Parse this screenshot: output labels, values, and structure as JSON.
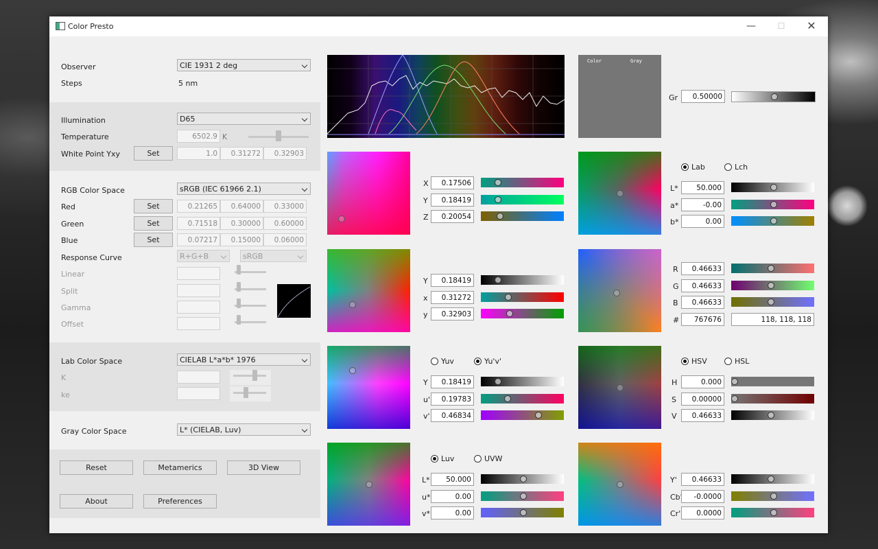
{
  "window": {
    "title": "Color Presto"
  },
  "left": {
    "observer": {
      "label": "Observer",
      "value": "CIE 1931 2 deg"
    },
    "steps": {
      "label": "Steps",
      "value": "5 nm"
    },
    "illumination": {
      "label": "Illumination",
      "value": "D65"
    },
    "temperature": {
      "label": "Temperature",
      "value": "6502.9",
      "unit": "K",
      "slider_fraction": 0.55
    },
    "white_point": {
      "label": "White Point Yxy",
      "button": "Set",
      "Y": "1.0",
      "x": "0.31272",
      "y": "0.32903"
    },
    "rgb_space": {
      "label": "RGB Color Space",
      "value": "sRGB (IEC 61966 2.1)"
    },
    "red": {
      "label": "Red",
      "button": "Set",
      "v1": "0.21265",
      "v2": "0.64000",
      "v3": "0.33000"
    },
    "green": {
      "label": "Green",
      "button": "Set",
      "v1": "0.71518",
      "v2": "0.30000",
      "v3": "0.60000"
    },
    "blue": {
      "label": "Blue",
      "button": "Set",
      "v1": "0.07217",
      "v2": "0.15000",
      "v3": "0.06000"
    },
    "response": {
      "label": "Response Curve",
      "channel": "R+G+B",
      "curve": "sRGB"
    },
    "params": [
      "Linear",
      "Split",
      "Gamma",
      "Offset"
    ],
    "lab_space": {
      "label": "Lab Color Space",
      "value": "CIELAB L*a*b* 1976",
      "k": "K",
      "ke": "ke"
    },
    "gray_space": {
      "label": "Gray Color Space",
      "value": "L* (CIELAB, Luv)"
    },
    "buttons": {
      "reset": "Reset",
      "metamerics": "Metamerics",
      "view3d": "3D View",
      "about": "About",
      "preferences": "Preferences"
    }
  },
  "gray_swatch": {
    "color_label": "Color",
    "gray_label": "Gray"
  },
  "gr": {
    "label": "Gr",
    "value": "0.50000",
    "fraction": 0.5
  },
  "xyz": {
    "rows": [
      {
        "label": "X",
        "value": "0.17506",
        "fraction": 0.18
      },
      {
        "label": "Y",
        "value": "0.18419",
        "fraction": 0.18
      },
      {
        "label": "Z",
        "value": "0.20054",
        "fraction": 0.2
      }
    ]
  },
  "yxy": {
    "rows": [
      {
        "label": "Y",
        "value": "0.18419",
        "fraction": 0.18
      },
      {
        "label": "x",
        "value": "0.31272",
        "fraction": 0.31
      },
      {
        "label": "y",
        "value": "0.32903",
        "fraction": 0.33
      }
    ]
  },
  "yuv": {
    "opt1": "Yuv",
    "opt2": "Yu'v'",
    "selected": "Yu'v'",
    "rows": [
      {
        "label": "Y",
        "value": "0.18419",
        "fraction": 0.18
      },
      {
        "label": "u'",
        "value": "0.19783",
        "fraction": 0.3
      },
      {
        "label": "v'",
        "value": "0.46834",
        "fraction": 0.7
      }
    ]
  },
  "luv": {
    "opt1": "Luv",
    "opt2": "UVW",
    "selected": "Luv",
    "rows": [
      {
        "label": "L*",
        "value": "50.000",
        "fraction": 0.5
      },
      {
        "label": "u*",
        "value": "0.00",
        "fraction": 0.5
      },
      {
        "label": "v*",
        "value": "0.00",
        "fraction": 0.5
      }
    ]
  },
  "lab": {
    "opt1": "Lab",
    "opt2": "Lch",
    "selected": "Lab",
    "rows": [
      {
        "label": "L*",
        "value": "50.000",
        "fraction": 0.5
      },
      {
        "label": "a*",
        "value": "-0.00",
        "fraction": 0.5
      },
      {
        "label": "b*",
        "value": "0.00",
        "fraction": 0.5
      }
    ]
  },
  "rgb": {
    "rows": [
      {
        "label": "R",
        "value": "0.46633",
        "fraction": 0.47
      },
      {
        "label": "G",
        "value": "0.46633",
        "fraction": 0.47
      },
      {
        "label": "B",
        "value": "0.46633",
        "fraction": 0.47
      }
    ],
    "hex_label": "#",
    "hex": "767676",
    "triplet": "118, 118, 118"
  },
  "hsv": {
    "opt1": "HSV",
    "opt2": "HSL",
    "selected": "HSV",
    "rows": [
      {
        "label": "H",
        "value": "0.000",
        "fraction": 0.0
      },
      {
        "label": "S",
        "value": "0.00000",
        "fraction": 0.0
      },
      {
        "label": "V",
        "value": "0.46633",
        "fraction": 0.47
      }
    ]
  },
  "ycbcr": {
    "rows": [
      {
        "label": "Y'",
        "value": "0.46633",
        "fraction": 0.47
      },
      {
        "label": "Cb'",
        "value": "-0.0000",
        "fraction": 0.5
      },
      {
        "label": "Cr'",
        "value": "0.0000",
        "fraction": 0.5
      }
    ]
  }
}
